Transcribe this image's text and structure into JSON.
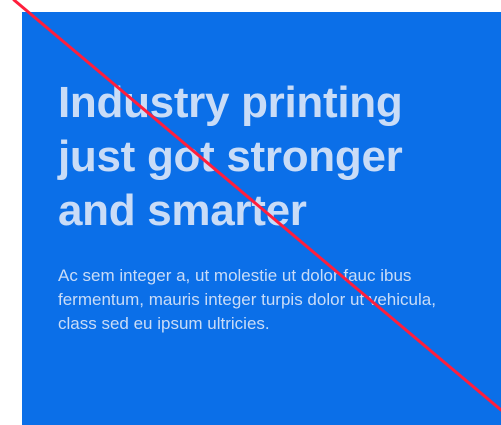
{
  "hero": {
    "headline": "Industry printing just got stronger and smarter",
    "body": "Ac sem integer a, ut molestie ut dolor fauc ibus fermentum, mauris integer turpis dolor ut vehicula, class sed eu ipsum ultricies."
  },
  "colors": {
    "card_background": "#0b6fe8",
    "text": "#c9dcf7",
    "strike_line": "#ff1e3c"
  }
}
